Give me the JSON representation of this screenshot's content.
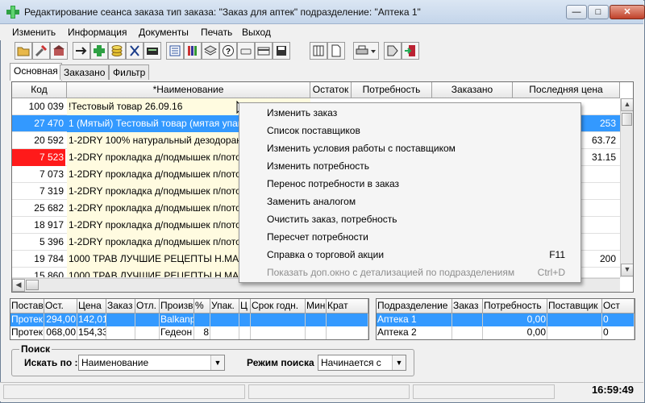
{
  "window": {
    "title": "Редактирование сеанса заказа тип заказа: \"Заказ для аптек\" подразделение: \"Аптека 1\"",
    "minimize_glyph": "—",
    "maximize_glyph": "□",
    "close_glyph": "✕"
  },
  "menu": [
    "Изменить",
    "Информация",
    "Документы",
    "Печать",
    "Выход"
  ],
  "toolbar_icons": [
    "open-folder-icon",
    "tools-icon",
    "warehouse-icon",
    "arrow-icon",
    "add-green-cross-icon",
    "coins-icon",
    "cut-icon",
    "calculator-icon",
    "list-icon",
    "books-icon",
    "layers-icon",
    "help-icon",
    "eraser-icon",
    "card-icon",
    "floppy-icon",
    "columns-icon",
    "page-icon",
    "printer-icon",
    "dropdown-icon",
    "tag-icon",
    "exit-door-icon"
  ],
  "tabs": [
    "Основная",
    "Заказано",
    "Фильтр"
  ],
  "grid": {
    "columns": [
      "Код",
      "*Наименование",
      "Остаток",
      "Потребность",
      "Заказано",
      "Последняя цена"
    ],
    "rows": [
      {
        "code": "100 039",
        "name": "!Тестовый товар 26.09.16",
        "price": ""
      },
      {
        "code": "27 470",
        "name": "1 (Мятый) Тестовый товар (мятая упаковка)",
        "price": "253"
      },
      {
        "code": "20 592",
        "name": "1-2DRY 100% натуральный дезодорант",
        "price": "63.72"
      },
      {
        "code": "7 523",
        "name": "1-2DRY прокладка д/подмышек п/потоотделения",
        "price": "31.15"
      },
      {
        "code": "7 073",
        "name": "1-2DRY прокладка д/подмышек п/потоотделения",
        "price": ""
      },
      {
        "code": "7 319",
        "name": "1-2DRY прокладка д/подмышек п/потоотделения",
        "price": ""
      },
      {
        "code": "25 682",
        "name": "1-2DRY прокладка д/подмышек п/потоотделения",
        "price": ""
      },
      {
        "code": "18 917",
        "name": "1-2DRY прокладка д/подмышек п/потоотделения",
        "price": ""
      },
      {
        "code": "5 396",
        "name": "1-2DRY прокладка д/подмышек п/потоотделения",
        "price": ""
      },
      {
        "code": "19 784",
        "name": "1000 ТРАВ ЛУЧШИЕ РЕЦЕПТЫ Н.МАЗНЕВ",
        "price": "200"
      },
      {
        "code": "15 860",
        "name": "1000 ТРАВ ЛУЧШИЕ РЕЦЕПТЫ Н.МАЗНЕВ",
        "price": ""
      },
      {
        "code": "18 785",
        "name": "1000 ТРАВ ЛУЧШИЕ РЕЦЕПТЫ Н.МАЗНЕВ",
        "price": ""
      }
    ]
  },
  "context_menu": [
    {
      "label": "Изменить заказ",
      "shortcut": "",
      "disabled": false
    },
    {
      "label": "Список поставщиков",
      "shortcut": "",
      "disabled": false
    },
    {
      "label": "Изменить условия работы с поставщиком",
      "shortcut": "",
      "disabled": false
    },
    {
      "label": "Изменить потребность",
      "shortcut": "",
      "disabled": false
    },
    {
      "label": "Перенос потребности в заказ",
      "shortcut": "",
      "disabled": false
    },
    {
      "label": "Заменить аналогом",
      "shortcut": "",
      "disabled": false
    },
    {
      "label": "Очистить заказ, потребность",
      "shortcut": "",
      "disabled": false
    },
    {
      "label": "Пересчет потребности",
      "shortcut": "",
      "disabled": false
    },
    {
      "label": "Справка о торговой акции",
      "shortcut": "F11",
      "disabled": false
    },
    {
      "label": "Показать доп.окно с детализацией по подразделениям",
      "shortcut": "Ctrl+D",
      "disabled": true
    }
  ],
  "suppliers": {
    "columns": [
      "Поставщ",
      "Ост.",
      "Цена",
      "Заказ",
      "Отл.",
      "Произв",
      "%",
      "Упак.",
      "Ц",
      "Срок годн.",
      "Мин",
      "Крат"
    ],
    "rows": [
      [
        "Протек",
        "294,00",
        "142,01",
        "",
        "",
        "Balkanph",
        "",
        "",
        "",
        "",
        "",
        ""
      ],
      [
        "Протек",
        "068,00",
        "154,33",
        "",
        "",
        "Гедеон",
        "8",
        "",
        "",
        "",
        "",
        ""
      ]
    ]
  },
  "departments": {
    "columns": [
      "Подразделение",
      "Заказ",
      "Потребность",
      "Поставщик",
      "Ост"
    ],
    "rows": [
      [
        "Аптека 1",
        "",
        "0,00",
        "",
        "0"
      ],
      [
        "Аптека 2",
        "",
        "0,00",
        "",
        "0"
      ]
    ]
  },
  "search": {
    "title": "Поиск",
    "search_by_label": "Искать по :",
    "search_by_value": "Наименование",
    "mode_label": "Режим поиска",
    "mode_value": "Начинается с"
  },
  "status": {
    "clock": "16:59:49"
  }
}
